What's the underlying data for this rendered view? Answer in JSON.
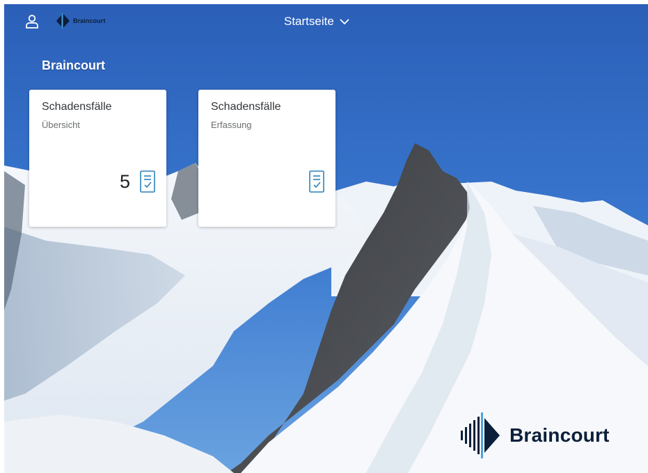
{
  "shell": {
    "app_title": "Startseite",
    "logo_text": "Braincourt"
  },
  "group": {
    "title": "Braincourt"
  },
  "tiles": [
    {
      "title": "Schadensfälle",
      "subtitle": "Übersicht",
      "count": "5",
      "icon": "task-list-icon"
    },
    {
      "title": "Schadensfälle",
      "subtitle": "Erfassung",
      "icon": "task-list-icon"
    }
  ],
  "brand": {
    "logo_text": "Braincourt"
  },
  "colors": {
    "sky": "#2f68c0",
    "tile_bg": "#ffffff",
    "icon_accent": "#2a82b7",
    "brand_blue": "#0b1f3a"
  }
}
